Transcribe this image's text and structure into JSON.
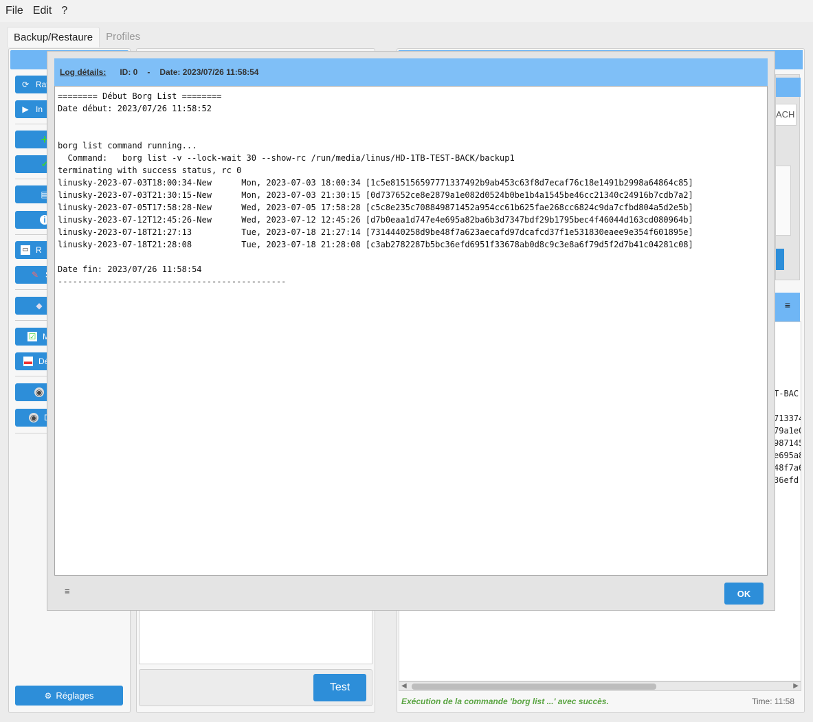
{
  "menu": {
    "file": "File",
    "edit": "Edit",
    "help": "?"
  },
  "tabs": {
    "backup": "Backup/Restaure",
    "profiles": "Profiles"
  },
  "sidebar": {
    "items": [
      {
        "label": "Rafr",
        "icon": "refresh-icon",
        "glyph": "⟳"
      },
      {
        "label": "In",
        "icon": "play-icon",
        "glyph": "▶"
      },
      {
        "label": "",
        "icon": "add-icon",
        "glyph": "+"
      },
      {
        "label": "",
        "icon": "check-icon",
        "glyph": "✔"
      },
      {
        "label": "",
        "icon": "document-icon",
        "glyph": "▤"
      },
      {
        "label": "",
        "icon": "info-icon",
        "glyph": "i"
      },
      {
        "label": "R",
        "icon": "window-icon",
        "glyph": "▭"
      },
      {
        "label": "S",
        "icon": "edit-icon",
        "glyph": "✎"
      },
      {
        "label": "",
        "icon": "package-icon",
        "glyph": "◆"
      },
      {
        "label": "M",
        "icon": "mount-icon",
        "glyph": "☑"
      },
      {
        "label": "Dé",
        "icon": "unmount-icon",
        "glyph": "▬"
      },
      {
        "label": "",
        "icon": "disk-add-icon",
        "glyph": "◉"
      },
      {
        "label": "D",
        "icon": "disk-icon",
        "glyph": "◉"
      }
    ],
    "settings_label": "Réglages"
  },
  "middle": {
    "test_label": "Test"
  },
  "right": {
    "field_fragment": "ACH",
    "wrap_glyph": "≡",
    "output_fragments": [
      "T-BAC",
      "",
      "713374",
      "79a1e0",
      "987145",
      "e695a8",
      "48f7a6",
      "36efd"
    ],
    "status": "Exécution de la commande 'borg list ...' avec succès.",
    "time": "Time: 11:58"
  },
  "dialog": {
    "title_label": "Log détails:",
    "id_text": "ID: 0",
    "separator": "-",
    "date_text": "Date: 2023/07/26 11:58:54",
    "lines": [
      "======== Début Borg List ========",
      "Date début: 2023/07/26 11:58:52",
      "",
      "",
      "borg list command running...",
      "  Command:   borg list -v --lock-wait 30 --show-rc /run/media/linus/HD-1TB-TEST-BACK/backup1",
      "terminating with success status, rc 0",
      "linusky-2023-07-03T18:00:34-New      Mon, 2023-07-03 18:00:34 [1c5e815156597771337492b9ab453c63f8d7ecaf76c18e1491b2998a64864c85]",
      "linusky-2023-07-03T21:30:15-New      Mon, 2023-07-03 21:30:15 [0d737652ce8e2879a1e082d0524b0be1b4a1545be46cc21340c24916b7cdb7a2]",
      "linusky-2023-07-05T17:58:28-New      Wed, 2023-07-05 17:58:28 [c5c8e235c708849871452a954cc61b625fae268cc6824c9da7cfbd804a5d2e5b]",
      "linusky-2023-07-12T12:45:26-New      Wed, 2023-07-12 12:45:26 [d7b0eaa1d747e4e695a82ba6b3d7347bdf29b1795bec4f46044d163cd080964b]",
      "linusky-2023-07-18T21:27:13          Tue, 2023-07-18 21:27:14 [7314440258d9be48f7a623aecafd97dcafcd37f1e531830eaee9e354f601895e]",
      "linusky-2023-07-18T21:28:08          Tue, 2023-07-18 21:28:08 [c3ab2782287b5bc36efd6951f33678ab0d8c9c3e8a6f79d5f2d7b41c04281c08]",
      "",
      "Date fin: 2023/07/26 11:58:54",
      "----------------------------------------------"
    ],
    "ok_label": "OK",
    "wrap_glyph": "≡"
  }
}
